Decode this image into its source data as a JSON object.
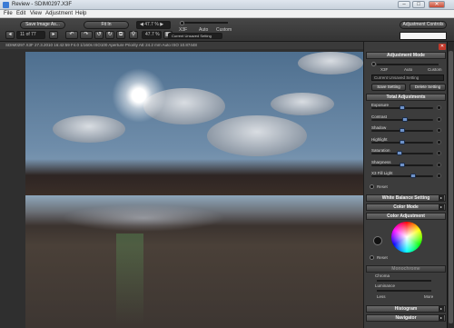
{
  "window": {
    "title": "Review - SDIM0297.X3F",
    "minimize": "–",
    "maximize": "□",
    "close": "✕"
  },
  "menu": [
    "File",
    "Edit",
    "View",
    "Adjustment",
    "Help"
  ],
  "toolbar": {
    "save_image": "Save Image As...",
    "fit": "Fit In",
    "nav_prev": "◀",
    "nav_next": "▶",
    "counter": "11 of 77",
    "zoom_value": "47.7 %",
    "zoom_label": "◀ 47.7 % ▶",
    "mode_labels": [
      "X3F",
      "Auto",
      "Custom"
    ],
    "setting_value": "Current Unsaved Setting",
    "adjustment_controls": "Adjustment Controls"
  },
  "infobar": "SDIM0297.X3F 27.3.2010 16:42:59 F4.0 1/160s ISO100 Aperture Priority AE 24.2 mm Auto ISO 10.87448",
  "panel": {
    "adjustment_mode": "Adjustment Mode",
    "modes": [
      "X3F",
      "Auto",
      "Custom"
    ],
    "dropdown": "Current Unsaved Setting",
    "save_setting": "Save Setting",
    "delete_setting": "Delete Setting",
    "total_adjustments": "Total Adjustments",
    "sliders": [
      "Exposure",
      "Contrast",
      "Shadow",
      "Highlight",
      "Saturation",
      "Sharpness",
      "X3 Fill Light"
    ],
    "slider_positions": [
      0.5,
      0.55,
      0.5,
      0.5,
      0.45,
      0.5,
      0.7
    ],
    "reset": "Reset",
    "white_balance": "White Balance Setting",
    "color_mode": "Color Mode",
    "color_adjustment": "Color Adjustment",
    "reset2": "Reset",
    "monochrome": "Monochrome",
    "sub_sliders": [
      "Chroma",
      "Luminance"
    ],
    "sub_labels": [
      "Less",
      "More"
    ],
    "histogram": "Histogram",
    "navigator": "Navigator"
  }
}
